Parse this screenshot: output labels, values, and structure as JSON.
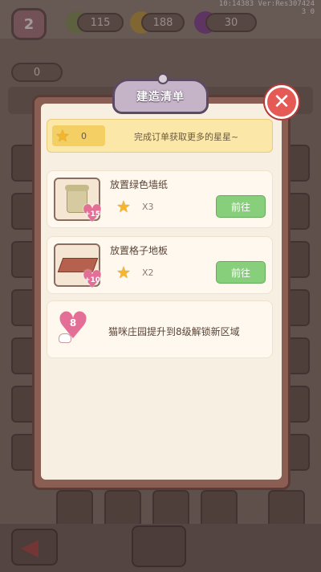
{
  "background": {
    "level": "2",
    "resources": [
      "115",
      "188",
      "30"
    ],
    "stars": "0",
    "debug_line1": "10:14383  Ver:Res307424",
    "debug_line2": "3        0"
  },
  "dialog": {
    "title": "建造清单",
    "banner_star_count": "0",
    "banner_text": "完成订单获取更多的星星~",
    "tasks": [
      {
        "name": "放置绿色墙纸",
        "heart_value": "+15",
        "quantity": "X3",
        "button": "前往",
        "icon": "wallpaper-scroll-icon"
      },
      {
        "name": "放置格子地板",
        "heart_value": "+10",
        "quantity": "X2",
        "button": "前往",
        "icon": "floor-tile-icon"
      }
    ],
    "unlock": {
      "heart_level": "8",
      "text": "猫咪庄园提升到8级解锁新区域"
    }
  },
  "colors": {
    "accent_green": "#88cf7c",
    "close_red": "#e65a55",
    "heart_pink": "#e46f96",
    "star_yellow": "#f6b52b"
  }
}
